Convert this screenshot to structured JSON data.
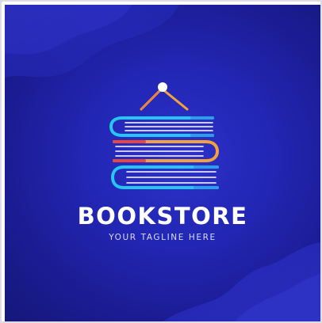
{
  "brand": {
    "name": "BOOKSTORE",
    "tagline": "YOUR TAGLINE HERE"
  },
  "logo": {
    "icon": "stacked-books-icon",
    "colors": {
      "background": "#2226b4",
      "cyan": "#27c6f0",
      "orange": "#f3a13c",
      "red": "#e8473f",
      "white": "#ffffff"
    }
  }
}
